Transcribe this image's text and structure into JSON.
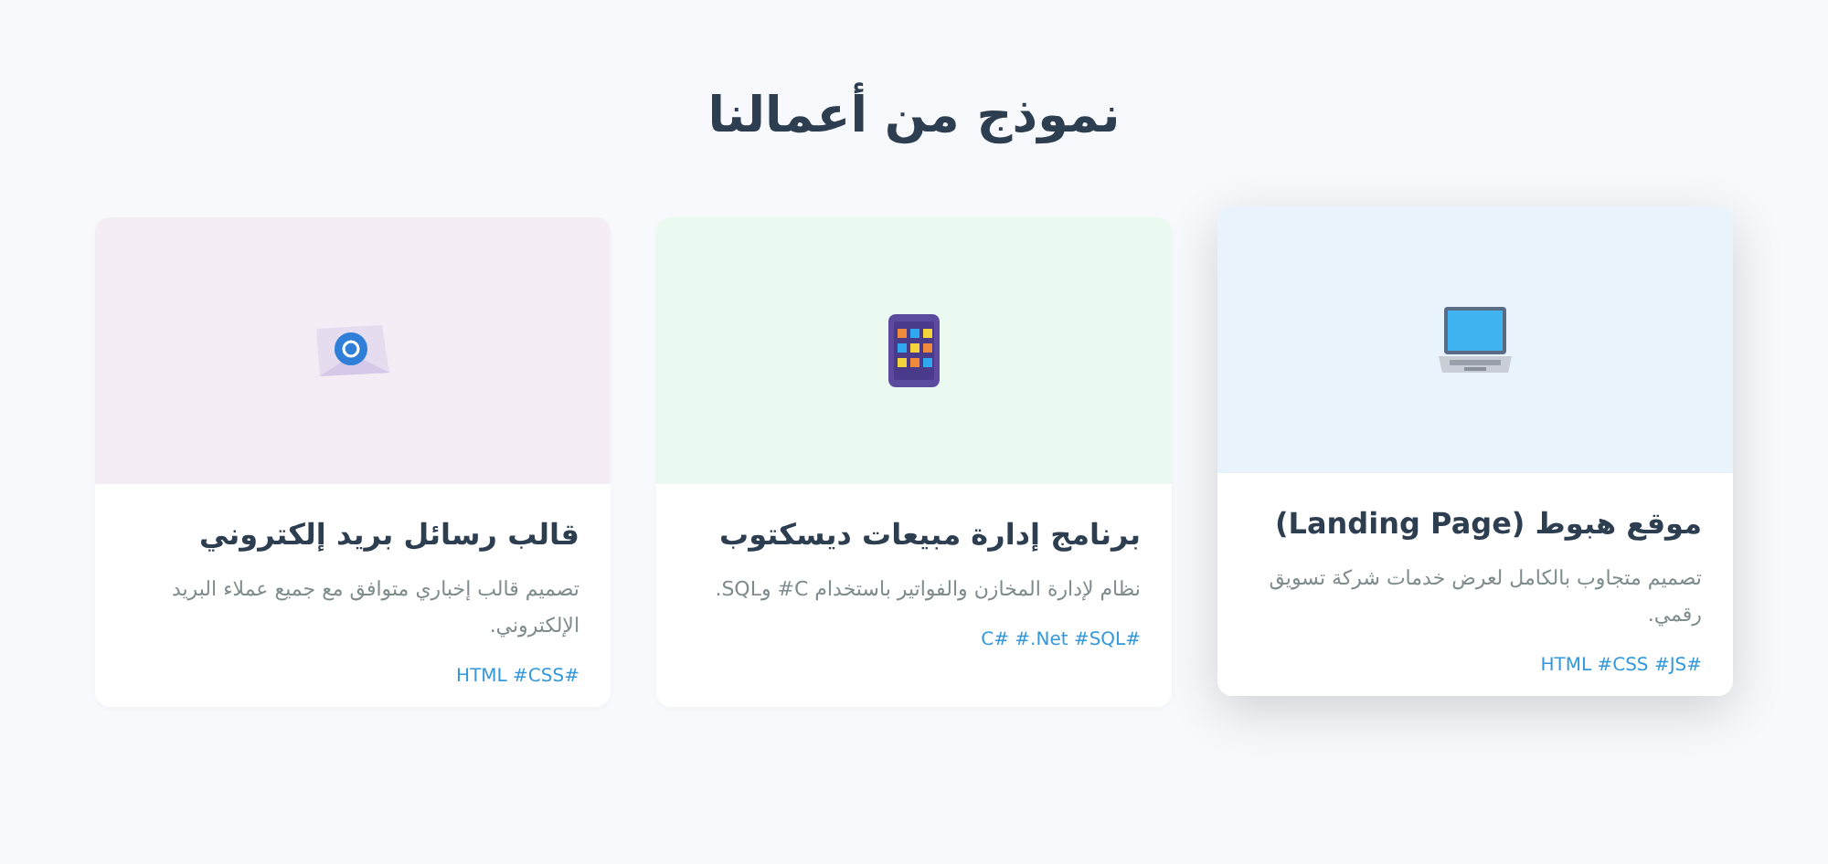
{
  "section_title": "نموذج من أعمالنا",
  "projects": [
    {
      "kind": "laptop",
      "highlighted": true,
      "color": "#e8f3fc",
      "title": "موقع هبوط (Landing Page)",
      "description": "تصميم متجاوب بالكامل لعرض خدمات شركة تسويق رقمي.",
      "tags": "HTML #CSS #JS#"
    },
    {
      "kind": "tablet",
      "highlighted": false,
      "color": "#eafaf0",
      "title": "برنامج إدارة مبيعات ديسكتوب",
      "description": "نظام لإدارة المخازن والفواتير باستخدام C# وSQL.",
      "tags": "C# #.Net #SQL#"
    },
    {
      "kind": "mail",
      "highlighted": false,
      "color": "#f5edf5",
      "title": "قالب رسائل بريد إلكتروني",
      "description": "تصميم قالب إخباري متوافق مع جميع عملاء البريد الإلكتروني.",
      "tags": "HTML #CSS#"
    }
  ]
}
